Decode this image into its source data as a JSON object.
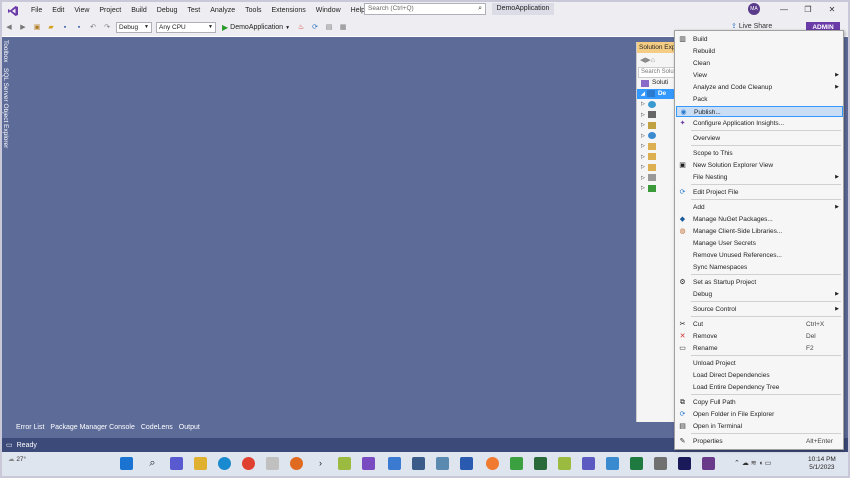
{
  "menubar": {
    "items": [
      "File",
      "Edit",
      "View",
      "Project",
      "Build",
      "Debug",
      "Test",
      "Analyze",
      "Tools",
      "Extensions",
      "Window",
      "Help"
    ],
    "search_placeholder": "Search (Ctrl+Q)",
    "solution_name": "DemoApplication",
    "avatar_initials": "MA"
  },
  "toolbar": {
    "config": "Debug",
    "platform": "Any CPU",
    "run_target": "DemoApplication",
    "live_share": "Live Share",
    "admin": "ADMIN"
  },
  "side_tabs": [
    "Toolbox",
    "SQL Server Object Explorer"
  ],
  "bottom_tabs": [
    "Error List",
    "Package Manager Console",
    "CodeLens",
    "Output"
  ],
  "solution_explorer": {
    "title": "Solution Exp",
    "search": "Search Solu",
    "rows": [
      "Soluti",
      "De"
    ]
  },
  "status": {
    "text": "Ready"
  },
  "taskbar": {
    "temp": "27°",
    "time": "10:14 PM",
    "date": "5/1/2023"
  },
  "context_menu": {
    "items": [
      {
        "label": "Build",
        "icon": "build-icon"
      },
      {
        "label": "Rebuild"
      },
      {
        "label": "Clean"
      },
      {
        "label": "View",
        "submenu": true
      },
      {
        "label": "Analyze and Code Cleanup",
        "submenu": true
      },
      {
        "label": "Pack"
      },
      {
        "label": "Publish...",
        "icon": "globe-icon",
        "highlighted": true
      },
      {
        "label": "Configure Application Insights...",
        "icon": "insights-icon"
      },
      {
        "label": "Overview"
      },
      {
        "label": "Scope to This"
      },
      {
        "label": "New Solution Explorer View",
        "icon": "window-icon"
      },
      {
        "label": "File Nesting",
        "submenu": true
      },
      {
        "label": "Edit Project File",
        "icon": "refresh-icon"
      },
      {
        "label": "Add",
        "submenu": true
      },
      {
        "label": "Manage NuGet Packages...",
        "icon": "nuget-icon"
      },
      {
        "label": "Manage Client-Side Libraries...",
        "icon": "library-icon"
      },
      {
        "label": "Manage User Secrets"
      },
      {
        "label": "Remove Unused References..."
      },
      {
        "label": "Sync Namespaces"
      },
      {
        "label": "Set as Startup Project",
        "icon": "gear-icon"
      },
      {
        "label": "Debug",
        "submenu": true
      },
      {
        "label": "Source Control",
        "submenu": true
      },
      {
        "label": "Cut",
        "icon": "scissors-icon",
        "shortcut": "Ctrl+X"
      },
      {
        "label": "Remove",
        "icon": "close-icon",
        "shortcut": "Del"
      },
      {
        "label": "Rename",
        "icon": "rename-icon",
        "shortcut": "F2"
      },
      {
        "label": "Unload Project"
      },
      {
        "label": "Load Direct Dependencies"
      },
      {
        "label": "Load Entire Dependency Tree"
      },
      {
        "label": "Copy Full Path",
        "icon": "copy-icon"
      },
      {
        "label": "Open Folder in File Explorer",
        "icon": "refresh-icon"
      },
      {
        "label": "Open in Terminal",
        "icon": "terminal-icon"
      },
      {
        "label": "Properties",
        "icon": "wrench-icon",
        "shortcut": "Alt+Enter"
      }
    ]
  }
}
